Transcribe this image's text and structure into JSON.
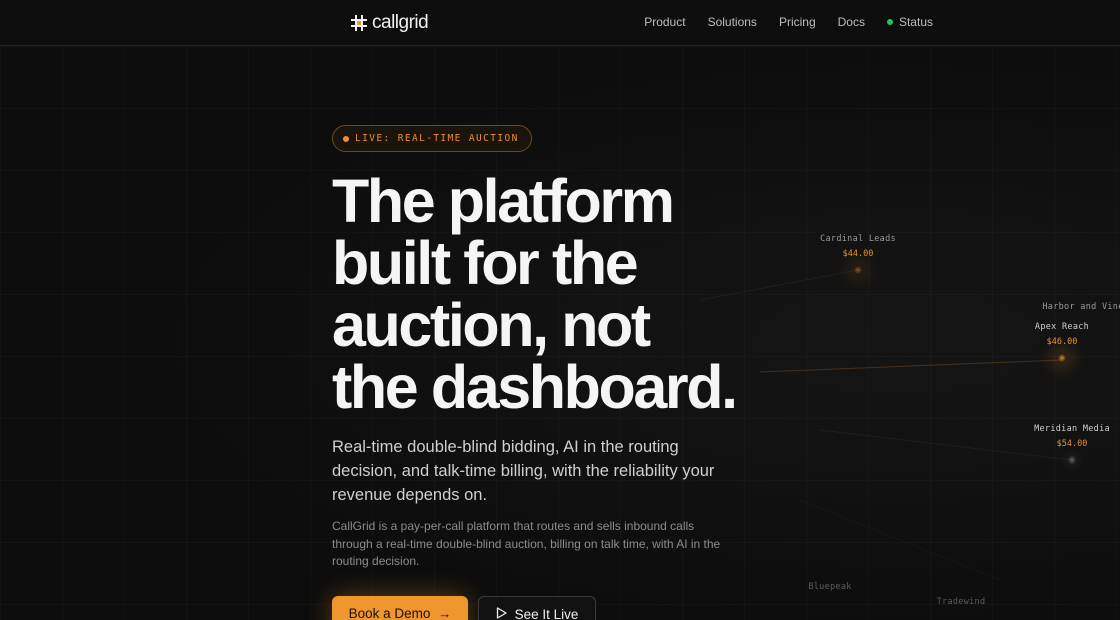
{
  "nav": {
    "logo_text": "callgrid",
    "links": [
      "Product",
      "Solutions",
      "Pricing",
      "Docs"
    ],
    "status_label": "Status"
  },
  "hero": {
    "badge": "LIVE: REAL-TIME AUCTION",
    "headline_lines": [
      "The platform",
      "built for the",
      "auction, not",
      "the dashboard."
    ],
    "subhead": "Real-time double-blind bidding, AI in the routing decision, and talk-time billing, with the reliability your revenue depends on.",
    "body": "CallGrid is a pay-per-call platform that routes and sells inbound calls through a real-time double-blind auction, billing on talk time, with AI in the routing decision.",
    "primary_cta": "Book a Demo",
    "secondary_cta": "See It Live"
  },
  "auction": {
    "bidders": [
      {
        "name": "Cardinal Leads",
        "price": "$44.00"
      },
      {
        "name": "Harbor and Vine",
        "price": ""
      },
      {
        "name": "Apex Reach",
        "price": "$46.00"
      },
      {
        "name": "Meridian Media",
        "price": "$54.00"
      },
      {
        "name": "Bluepeak",
        "price": ""
      },
      {
        "name": "Tradewind",
        "price": ""
      }
    ]
  },
  "colors": {
    "accent": "#f0962e",
    "background": "#0d0d0d",
    "status_ok": "#22c55e"
  }
}
